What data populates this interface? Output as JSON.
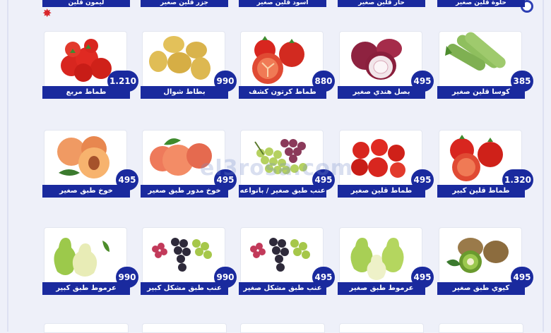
{
  "top_row": [
    {
      "name": "ليمون قلين"
    },
    {
      "name": "جزر قلين صغير"
    },
    {
      "name": "اسود قلين صغير"
    },
    {
      "name": "حار قلين صغير"
    },
    {
      "name": "حلوة قلين صغير"
    }
  ],
  "rows": [
    [
      {
        "name": "طماط مربع",
        "price": "1.210",
        "icon": "tomato-cluster-icon"
      },
      {
        "name": "بطاط شوال",
        "price": "990",
        "icon": "potato-icon"
      },
      {
        "name": "طماط كرتون كشف",
        "price": "880",
        "icon": "tomato-sliced-icon"
      },
      {
        "name": "بصل هندي صغير",
        "price": "495",
        "icon": "red-onion-icon"
      },
      {
        "name": "كوسا قلين صغير",
        "price": "385",
        "icon": "zucchini-icon"
      }
    ],
    [
      {
        "name": "خوخ طبق صغير",
        "price": "495",
        "icon": "peach-icon"
      },
      {
        "name": "خوخ مدور طبق صغير",
        "price": "495",
        "icon": "round-peach-icon"
      },
      {
        "name": "عنب طبق صغير / بانواعه",
        "price": "495",
        "icon": "grapes-mixed-icon"
      },
      {
        "name": "طماط قلين صغير",
        "price": "495",
        "icon": "cherry-tomato-icon"
      },
      {
        "name": "طماط قلين كبير",
        "price": "1.320",
        "icon": "tomato-large-icon"
      }
    ],
    [
      {
        "name": "عرموط طبق كبير",
        "price": "990",
        "icon": "pear-icon"
      },
      {
        "name": "عنب طبق مشكل كبير",
        "price": "990",
        "icon": "grapes-assorted-icon"
      },
      {
        "name": "عنب طبق مشكل صغير",
        "price": "495",
        "icon": "grapes-assorted-small-icon"
      },
      {
        "name": "عرموط طبق صغير",
        "price": "495",
        "icon": "pear-small-icon"
      },
      {
        "name": "كيوي طبق صغير",
        "price": "495",
        "icon": "kiwi-icon"
      }
    ]
  ],
  "watermark": "el3rosa.com",
  "colors": {
    "label_bg": "#1a2a9e",
    "page_bg": "#eef0f9",
    "accent_red": "#d9262c"
  }
}
